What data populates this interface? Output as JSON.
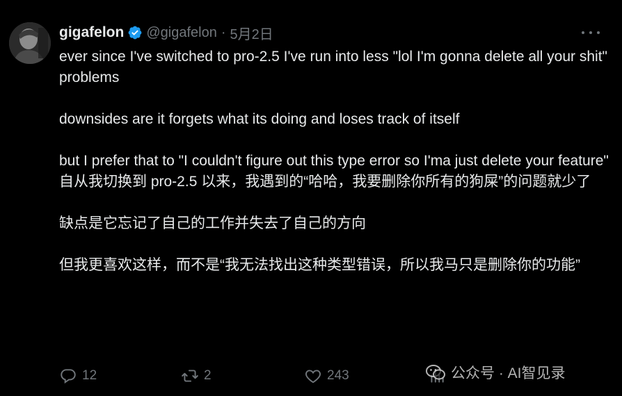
{
  "user": {
    "name": "gigafelon",
    "handle": "@gigafelon",
    "separator": "·",
    "date": "5月2日"
  },
  "tweet": {
    "paragraphs": [
      "ever since I've switched to pro-2.5 I've run into less \"lol I'm gonna delete all your shit\" problems",
      "downsides are it forgets what its doing and loses track of itself",
      "but I prefer that to \"I couldn't figure out this type error so I'ma just delete your feature\""
    ],
    "translation": [
      "自从我切换到 pro-2.5 以来，我遇到的“哈哈，我要删除你所有的狗屎”的问题就少了",
      "缺点是它忘记了自己的工作并失去了自己的方向",
      "但我更喜欢这样，而不是“我无法找出这种类型错误，所以我马只是删除你的功能”"
    ]
  },
  "actions": {
    "replies": "12",
    "retweets": "2",
    "likes": "243"
  },
  "watermark": "公众号 · AI智见录",
  "colors": {
    "background": "#000000",
    "text": "#e7e9ea",
    "muted": "#71767b",
    "verified": "#1d9bf0"
  },
  "icons": [
    "verified-badge-icon",
    "more-icon",
    "reply-icon",
    "retweet-icon",
    "like-icon",
    "views-icon"
  ]
}
